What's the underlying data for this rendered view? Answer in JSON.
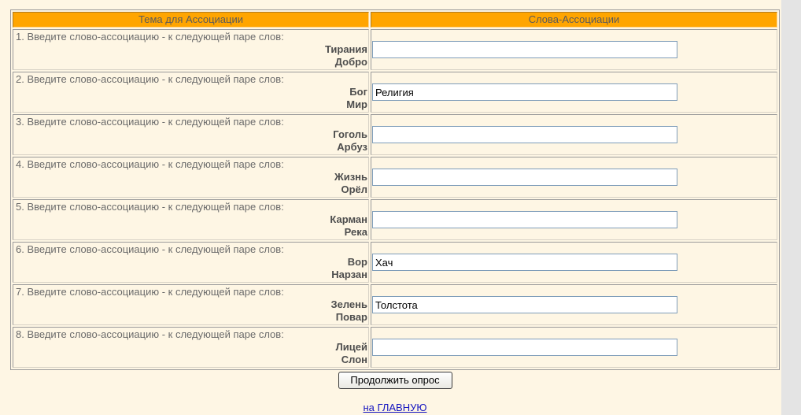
{
  "header": {
    "topic": "Тема для Ассоциации",
    "associations": "Слова-Ассоциации"
  },
  "rows": [
    {
      "prompt": "1. Введите слово-ассоциацию - к следующей паре слов:",
      "word1": "Тирания",
      "word2": "Добро",
      "value": ""
    },
    {
      "prompt": "2. Введите слово-ассоциацию - к следующей паре слов:",
      "word1": "Бог",
      "word2": "Мир",
      "value": "Религия"
    },
    {
      "prompt": "3. Введите слово-ассоциацию - к следующей паре слов:",
      "word1": "Гоголь",
      "word2": "Арбуз",
      "value": ""
    },
    {
      "prompt": "4. Введите слово-ассоциацию - к следующей паре слов:",
      "word1": "Жизнь",
      "word2": "Орёл",
      "value": ""
    },
    {
      "prompt": "5. Введите слово-ассоциацию - к следующей паре слов:",
      "word1": "Карман",
      "word2": "Река",
      "value": ""
    },
    {
      "prompt": "6. Введите слово-ассоциацию - к следующей паре слов:",
      "word1": "Вор",
      "word2": "Нарзан",
      "value": "Хач"
    },
    {
      "prompt": "7. Введите слово-ассоциацию - к следующей паре слов:",
      "word1": "Зелень",
      "word2": "Повар",
      "value": "Толстота"
    },
    {
      "prompt": "8. Введите слово-ассоциацию - к следующей паре слов:",
      "word1": "Лицей",
      "word2": "Слон",
      "value": ""
    }
  ],
  "actions": {
    "continue_label": "Продолжить опрос",
    "home_link": "на ГЛАВНУЮ"
  },
  "colors": {
    "page_bg": "#FEF6E4",
    "header_bg": "#FFA500",
    "link": "#1515C0",
    "side_bg": "#E4E4E4"
  }
}
